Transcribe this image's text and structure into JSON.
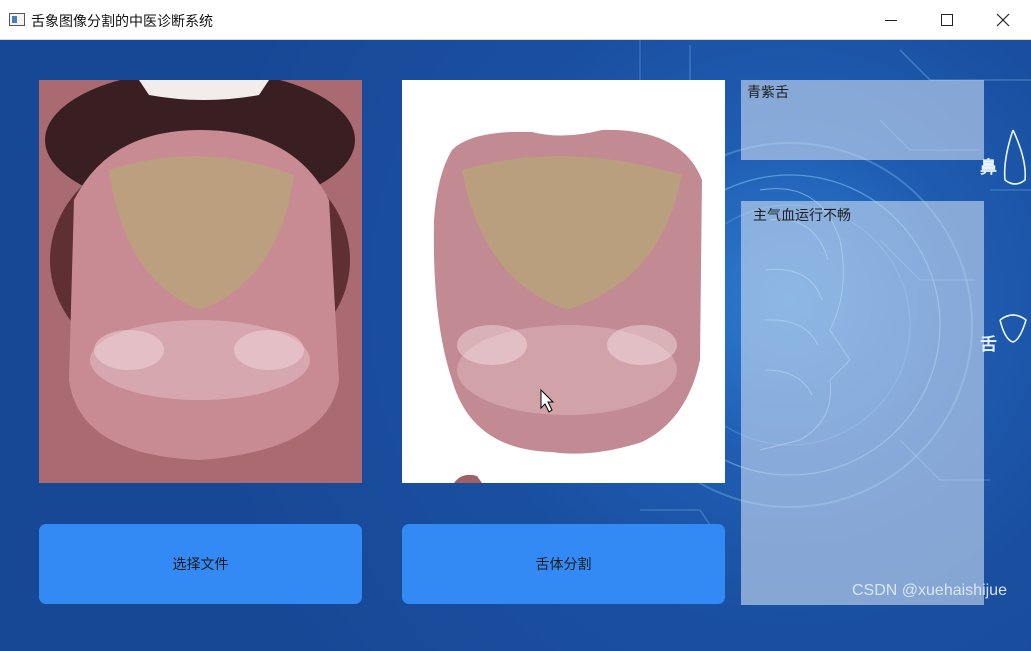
{
  "window": {
    "title": "舌象图像分割的中医诊断系统",
    "icon": "app-window-icon",
    "controls": [
      "minimize-icon",
      "maximize-icon",
      "close-icon"
    ]
  },
  "panels": {
    "original_image": "original-tongue-photo",
    "segmented_image": "segmented-tongue-photo"
  },
  "buttons": {
    "select_file": "选择文件",
    "segment": "舌体分割"
  },
  "results": {
    "tongue_type": "青紫舌",
    "diagnosis": "主气血运行不畅"
  },
  "background_labels": {
    "nose": "鼻",
    "tongue": "舌"
  },
  "watermark": "CSDN @xuehaishijue",
  "colors": {
    "background": "#1a4fa0",
    "button": "#338af5",
    "result_box": "#b7cdee"
  }
}
